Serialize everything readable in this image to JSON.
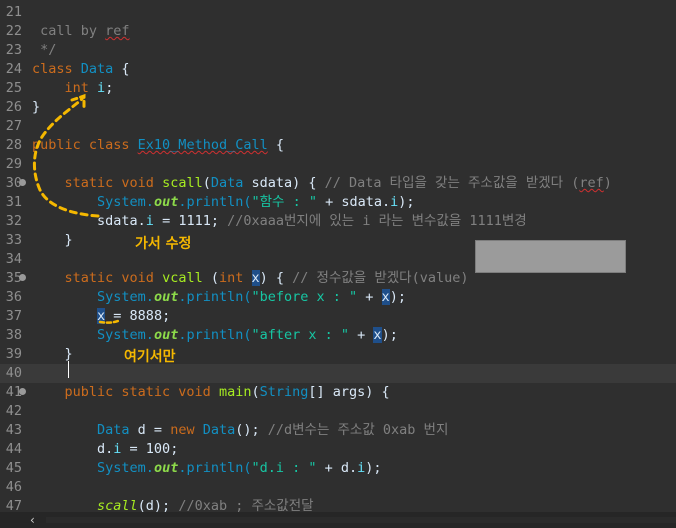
{
  "editor": {
    "lines": [
      {
        "num": "21",
        "parts": []
      },
      {
        "num": "22",
        "parts": [
          {
            "t": " call by ",
            "c": "cm"
          },
          {
            "t": "ref",
            "c": "cm squig"
          }
        ]
      },
      {
        "num": "23",
        "parts": [
          {
            "t": " */",
            "c": "cm"
          }
        ]
      },
      {
        "num": "24",
        "parts": [
          {
            "t": "class ",
            "c": "kw"
          },
          {
            "t": "Data",
            "c": "type"
          },
          {
            "t": " {",
            "c": ""
          }
        ]
      },
      {
        "num": "25",
        "parts": [
          {
            "t": "    ",
            "c": ""
          },
          {
            "t": "int",
            "c": "kw"
          },
          {
            "t": " ",
            "c": ""
          },
          {
            "t": "i",
            "c": "field"
          },
          {
            "t": ";",
            "c": ""
          }
        ]
      },
      {
        "num": "26",
        "parts": [
          {
            "t": "}",
            "c": ""
          }
        ]
      },
      {
        "num": "27",
        "parts": []
      },
      {
        "num": "28",
        "parts": [
          {
            "t": "public class ",
            "c": "kw"
          },
          {
            "t": "Ex10_Method_Call",
            "c": "type squig"
          },
          {
            "t": " {",
            "c": ""
          }
        ]
      },
      {
        "num": "29",
        "parts": []
      },
      {
        "num": "30",
        "fold": true,
        "parts": [
          {
            "t": "    ",
            "c": ""
          },
          {
            "t": "static void ",
            "c": "kw"
          },
          {
            "t": "scall",
            "c": "fn"
          },
          {
            "t": "(",
            "c": ""
          },
          {
            "t": "Data",
            "c": "type"
          },
          {
            "t": " sdata) { ",
            "c": ""
          },
          {
            "t": "// Data 타입을 갖는 주소값을 받겠다 (",
            "c": "cm"
          },
          {
            "t": "ref",
            "c": "cm squig"
          },
          {
            "t": ")",
            "c": "cm"
          }
        ]
      },
      {
        "num": "31",
        "parts": [
          {
            "t": "        ",
            "c": ""
          },
          {
            "t": "System.",
            "c": "type"
          },
          {
            "t": "out",
            "c": "out"
          },
          {
            "t": ".println(",
            "c": "type"
          },
          {
            "t": "\"함수 : \"",
            "c": "str"
          },
          {
            "t": " + sdata.",
            "c": ""
          },
          {
            "t": "i",
            "c": "field"
          },
          {
            "t": ");",
            "c": ""
          }
        ]
      },
      {
        "num": "32",
        "parts": [
          {
            "t": "        sdata.",
            "c": ""
          },
          {
            "t": "i",
            "c": "field"
          },
          {
            "t": " = 1111; ",
            "c": ""
          },
          {
            "t": "//0xaaa번지에 있는 i 라는 변수값을 1111변경",
            "c": "cm"
          }
        ]
      },
      {
        "num": "33",
        "parts": [
          {
            "t": "    }",
            "c": ""
          }
        ]
      },
      {
        "num": "34",
        "parts": []
      },
      {
        "num": "35",
        "fold": true,
        "parts": [
          {
            "t": "    ",
            "c": ""
          },
          {
            "t": "static void ",
            "c": "kw"
          },
          {
            "t": "vcall",
            "c": "fn"
          },
          {
            "t": " (",
            "c": ""
          },
          {
            "t": "int",
            "c": "kw"
          },
          {
            "t": " ",
            "c": ""
          },
          {
            "t": "x",
            "c": "hl"
          },
          {
            "t": ") { ",
            "c": ""
          },
          {
            "t": "// 정수값을 받겠다(value)",
            "c": "cm"
          }
        ]
      },
      {
        "num": "36",
        "parts": [
          {
            "t": "        ",
            "c": ""
          },
          {
            "t": "System.",
            "c": "type"
          },
          {
            "t": "out",
            "c": "out"
          },
          {
            "t": ".println(",
            "c": "type"
          },
          {
            "t": "\"before x : \"",
            "c": "str"
          },
          {
            "t": " + ",
            "c": ""
          },
          {
            "t": "x",
            "c": "hl"
          },
          {
            "t": ");",
            "c": ""
          }
        ]
      },
      {
        "num": "37",
        "parts": [
          {
            "t": "        ",
            "c": ""
          },
          {
            "t": "x",
            "c": "hl"
          },
          {
            "t": " = 8888;",
            "c": ""
          }
        ]
      },
      {
        "num": "38",
        "parts": [
          {
            "t": "        ",
            "c": ""
          },
          {
            "t": "System.",
            "c": "type"
          },
          {
            "t": "out",
            "c": "out"
          },
          {
            "t": ".println(",
            "c": "type"
          },
          {
            "t": "\"after x : \"",
            "c": "str"
          },
          {
            "t": " + ",
            "c": ""
          },
          {
            "t": "x",
            "c": "hl"
          },
          {
            "t": ");",
            "c": ""
          }
        ]
      },
      {
        "num": "39",
        "parts": [
          {
            "t": "    }",
            "c": ""
          }
        ]
      },
      {
        "num": "40",
        "current": true,
        "parts": []
      },
      {
        "num": "41",
        "fold": true,
        "parts": [
          {
            "t": "    ",
            "c": ""
          },
          {
            "t": "public static void ",
            "c": "kw"
          },
          {
            "t": "main",
            "c": "fn"
          },
          {
            "t": "(",
            "c": ""
          },
          {
            "t": "String",
            "c": "type"
          },
          {
            "t": "[] args) {",
            "c": ""
          }
        ]
      },
      {
        "num": "42",
        "parts": []
      },
      {
        "num": "43",
        "parts": [
          {
            "t": "        ",
            "c": ""
          },
          {
            "t": "Data",
            "c": "type"
          },
          {
            "t": " d = ",
            "c": ""
          },
          {
            "t": "new ",
            "c": "kw"
          },
          {
            "t": "Data",
            "c": "type"
          },
          {
            "t": "(); ",
            "c": ""
          },
          {
            "t": "//d변수는 주소값 0xab 번지",
            "c": "cm"
          }
        ]
      },
      {
        "num": "44",
        "parts": [
          {
            "t": "        d.",
            "c": ""
          },
          {
            "t": "i",
            "c": "field"
          },
          {
            "t": " = 100;",
            "c": ""
          }
        ]
      },
      {
        "num": "45",
        "parts": [
          {
            "t": "        ",
            "c": ""
          },
          {
            "t": "System.",
            "c": "type"
          },
          {
            "t": "out",
            "c": "out"
          },
          {
            "t": ".println(",
            "c": "type"
          },
          {
            "t": "\"d.i : \"",
            "c": "str"
          },
          {
            "t": " + d.",
            "c": ""
          },
          {
            "t": "i",
            "c": "field"
          },
          {
            "t": ");",
            "c": ""
          }
        ]
      },
      {
        "num": "46",
        "parts": []
      },
      {
        "num": "47",
        "parts": [
          {
            "t": "        ",
            "c": ""
          },
          {
            "t": "scall",
            "c": "sfn"
          },
          {
            "t": "(d); ",
            "c": ""
          },
          {
            "t": "//0xab ; 주소값전달",
            "c": "cm"
          }
        ]
      }
    ]
  },
  "annotations": {
    "note_1": "가서 수정",
    "note_2": "여기서만"
  },
  "scrollbar": {
    "left_arrow": "‹"
  },
  "colors": {
    "background": "#2f2f2f",
    "keyword": "#cc6c1d",
    "type": "#1290c3",
    "comment": "#808080",
    "string": "#17c6a3",
    "annotation": "#f5b800"
  }
}
